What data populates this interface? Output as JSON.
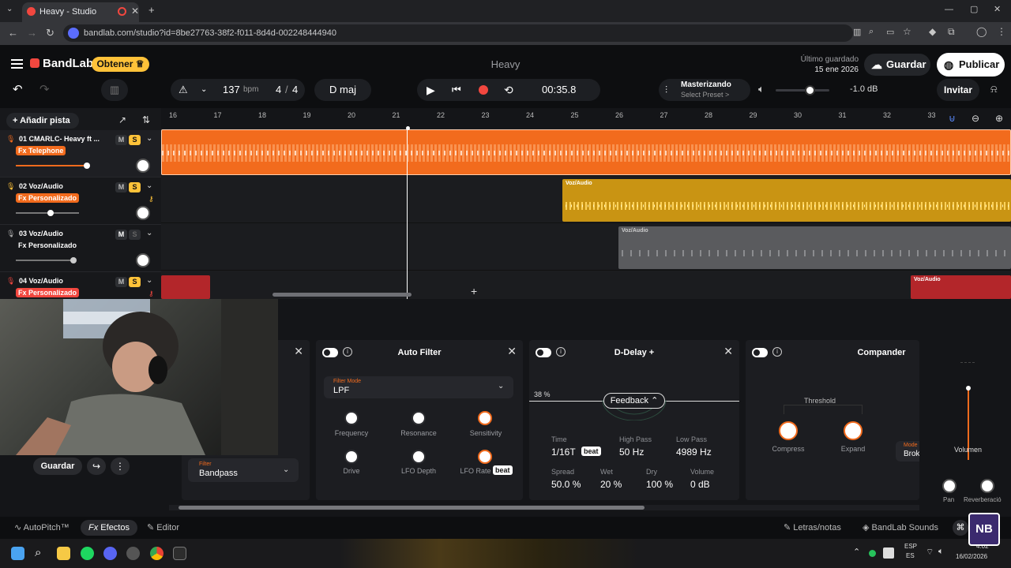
{
  "browser": {
    "tab_title": "Heavy - Studio",
    "url": "bandlab.com/studio?id=8be27763-38f2-f011-8d4d-002248444940",
    "new_tab": "+",
    "close_tab": "✕"
  },
  "header": {
    "brand": "BandLab",
    "obtener": "Obtener ♕",
    "song_title": "Heavy",
    "last_saved_label": "Último guardado",
    "last_saved_date": "15 ene 2026",
    "save": "Guardar",
    "publish": "Publicar"
  },
  "transport": {
    "tempo": "137",
    "tempo_unit": "bpm",
    "time_sig_num": "4",
    "time_sig_sep": "/",
    "time_sig_den": "4",
    "key": "D maj",
    "time": "00:35.8",
    "mastering_title": "Masterizando",
    "mastering_preset": "Select Preset >",
    "volume_db": "-1.0 dB",
    "invite": "Invitar"
  },
  "add_track": "Añadir pista",
  "ruler": [
    "16",
    "17",
    "18",
    "19",
    "20",
    "21",
    "22",
    "23",
    "24",
    "25",
    "26",
    "27",
    "28",
    "29",
    "30",
    "31",
    "32",
    "33"
  ],
  "tracks": [
    {
      "name": "01  CMARLC- Heavy ft ...",
      "fx": "Fx Telephone",
      "fx_color": "#f26b1d",
      "m": "M",
      "s": "S"
    },
    {
      "name": "02  Voz/Audio",
      "fx": "Fx Personalizado",
      "fx_color": "#f26b1d",
      "m": "M",
      "s": "S"
    },
    {
      "name": "03  Voz/Audio",
      "fx": "Fx Personalizado",
      "fx_color": "",
      "m": "M",
      "s": "S"
    },
    {
      "name": "04  Voz/Audio",
      "fx": "Fx Personalizado",
      "fx_color": "#f2473f",
      "m": "M",
      "s": "S"
    }
  ],
  "clips": {
    "label": "Voz/Audio"
  },
  "effects": {
    "left_filter_label": "Filter",
    "left_filter_value": "Bandpass",
    "auto_filter": {
      "title": "Auto Filter",
      "filter_mode_label": "Filter Mode",
      "filter_mode_value": "LPF",
      "knobs": [
        "Frequency",
        "Resonance",
        "Sensitivity",
        "Drive",
        "LFO Depth",
        "LFO Rate"
      ],
      "beat": "beat"
    },
    "delay": {
      "title": "D-Delay +",
      "percent": "38 %",
      "feedback": "Feedback ⌃",
      "time_label": "Time",
      "time_value": "1/16T",
      "beat": "beat",
      "highpass_label": "High Pass",
      "highpass_value": "50 Hz",
      "lowpass_label": "Low Pass",
      "lowpass_value": "4989 Hz",
      "spread_label": "Spread",
      "spread_value": "50.0 %",
      "wet_label": "Wet",
      "wet_value": "20 %",
      "dry_label": "Dry",
      "dry_value": "100 %",
      "volume_label": "Volume",
      "volume_value": "0 dB"
    },
    "compander": {
      "title": "Compander",
      "threshold": "Threshold",
      "compress": "Compress",
      "expand": "Expand",
      "mode_label": "Mode",
      "mode_value": "Brok"
    },
    "volume_label": "Volumen",
    "pan_label": "Pan",
    "reverb_label": "Reverberació"
  },
  "cam_controls": {
    "save": "Guardar"
  },
  "bottom": {
    "autopitch": "AutoPitch™",
    "effects": "Efectos",
    "editor": "Editor",
    "lyrics": "Letras/notas",
    "sounds": "BandLab Sounds"
  },
  "taskbar": {
    "lang": "ESP",
    "region": "ES",
    "time": "4:02",
    "date": "16/02/2026"
  }
}
